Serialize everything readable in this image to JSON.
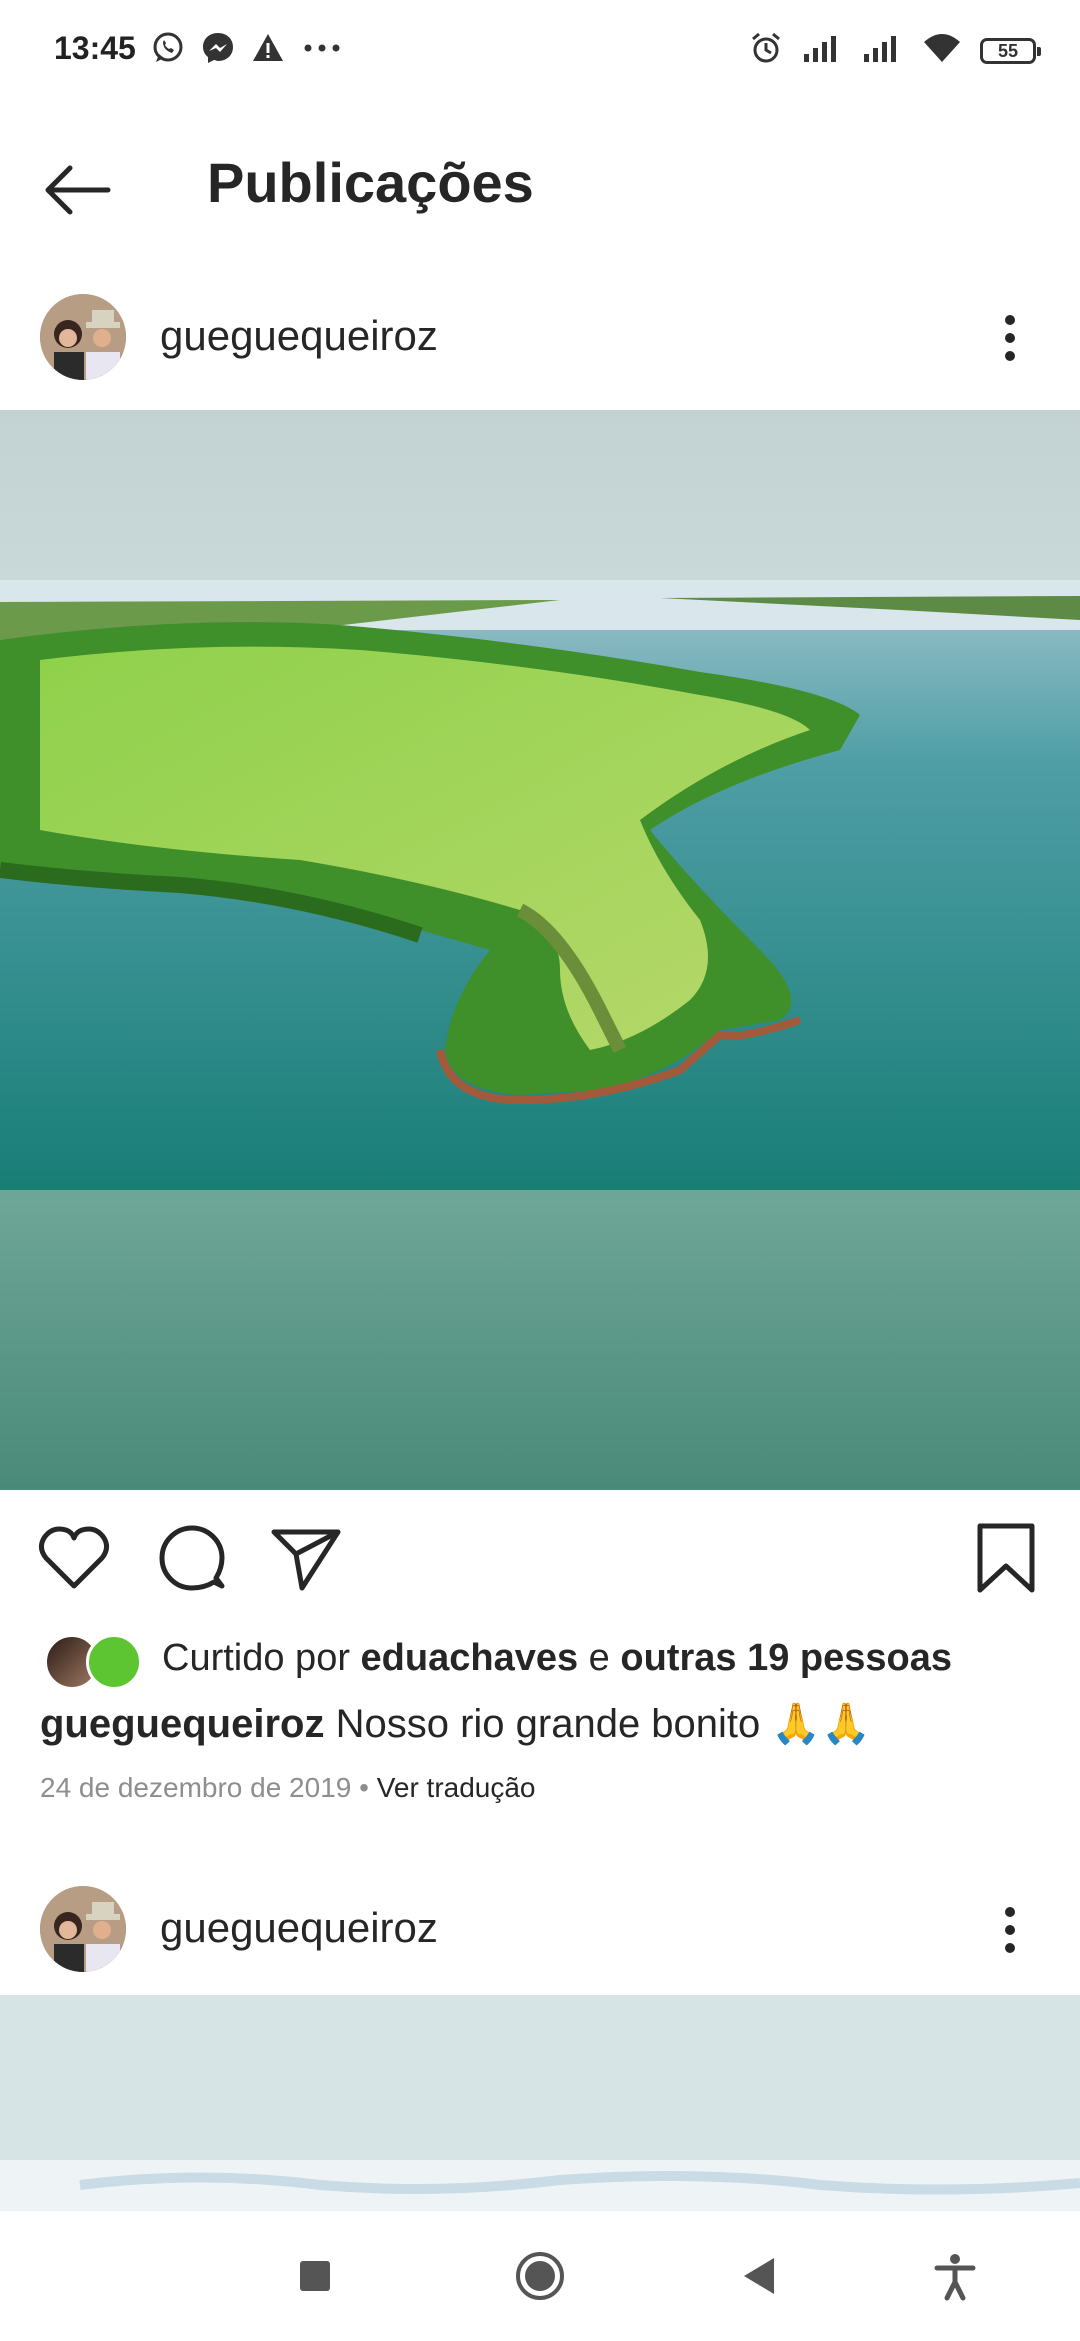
{
  "status_bar": {
    "time": "13:45",
    "left_icons": [
      "whatsapp-icon",
      "messenger-icon",
      "warning-icon",
      "more-dots-icon"
    ],
    "right_icons": [
      "alarm-icon",
      "signal-icon",
      "signal-icon",
      "wifi-icon"
    ],
    "battery": "55"
  },
  "app_bar": {
    "title": "Publicações",
    "back_icon": "arrow-left-icon"
  },
  "post": {
    "username": "gueguequeiroz",
    "likes": {
      "prefix": "Curtido por ",
      "liker": "eduachaves",
      "conjunction": " e ",
      "others": "outras 19 pessoas"
    },
    "caption_user": "gueguequeiroz",
    "caption_text": "Nosso rio  grande bonito 🙏🙏",
    "date": "24 de dezembro de 2019",
    "separator": "•",
    "translate": "Ver tradução"
  },
  "next_post": {
    "username": "gueguequeiroz"
  },
  "nav_bar": {
    "buttons": [
      "recents-square-icon",
      "home-circle-icon",
      "back-triangle-icon",
      "accessibility-icon"
    ]
  },
  "colors": {
    "text": "#262626",
    "muted": "#8e8e8e",
    "photo_sky": "#c8d6d6",
    "photo_water": "#2a8a80"
  }
}
